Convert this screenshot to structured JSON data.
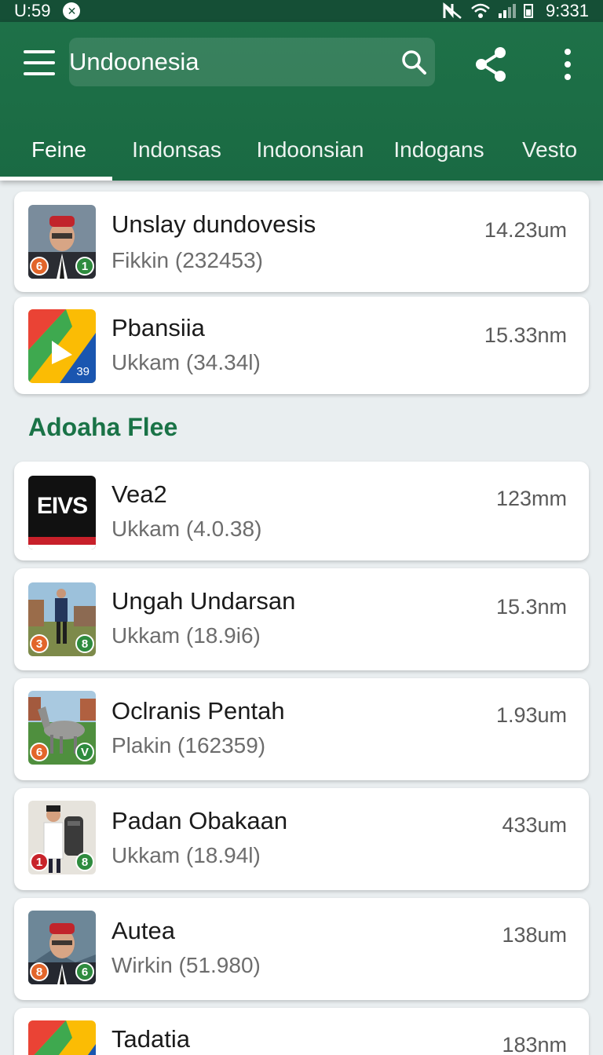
{
  "status_bar": {
    "time": "U:59",
    "right_time": "9:331",
    "icons": [
      "notification-icon",
      "nfc-icon",
      "wifi-icon",
      "signal-icon",
      "battery-icon"
    ]
  },
  "app_bar": {
    "search_value": "Undoonesia",
    "icons": [
      "menu-icon",
      "search-icon",
      "share-icon",
      "more-vert-icon"
    ]
  },
  "tabs": [
    {
      "label": "Feine",
      "active": true
    },
    {
      "label": "Indonsas",
      "active": false
    },
    {
      "label": "Indoonsian",
      "active": false
    },
    {
      "label": "Indogans",
      "active": false
    },
    {
      "label": "Vesto",
      "active": false
    }
  ],
  "top_items": [
    {
      "title": "Unslay dundovesis",
      "subtitle": "Fikkin (232453)",
      "size": "14.23um",
      "badge_left": "6",
      "badge_right": "1",
      "thumb": "portrait-red-cap"
    },
    {
      "title": "Pbansiia",
      "subtitle": "Ukkam (34.34l)",
      "size": "15.33nm",
      "badge_label": "39",
      "thumb": "maps-logo"
    }
  ],
  "section": {
    "title": "Adoaha Flee"
  },
  "items": [
    {
      "title": "Vea2",
      "subtitle": "Ukkam (4.0.38)",
      "size": "123mm",
      "logo_text": "EIVS",
      "thumb": "evs-logo"
    },
    {
      "title": "Ungah Undarsan",
      "subtitle": "Ukkam (18.9i6)",
      "size": "15.3nm",
      "badge_left": "3",
      "badge_right": "8",
      "thumb": "man-field"
    },
    {
      "title": "Oclranis Pentah",
      "subtitle": "Plakin (162359)",
      "size": "1.93um",
      "badge_left": "6",
      "badge_right": "V",
      "thumb": "animal-field"
    },
    {
      "title": "Padan Obakaan",
      "subtitle": "Ukkam (18.94l)",
      "size": "433um",
      "badge_left": "1",
      "badge_right": "8",
      "thumb": "man-machine"
    },
    {
      "title": "Autea",
      "subtitle": "Wirkin (51.980)",
      "size": "138um",
      "badge_left": "8",
      "badge_right": "6",
      "thumb": "portrait-red-cap"
    },
    {
      "title": "Tadatia",
      "subtitle": "",
      "size": "183nm",
      "thumb": "maps-logo"
    }
  ],
  "colors": {
    "app_bar": "#1e7148",
    "status_bar": "#154f36",
    "accent": "#1a7347"
  }
}
